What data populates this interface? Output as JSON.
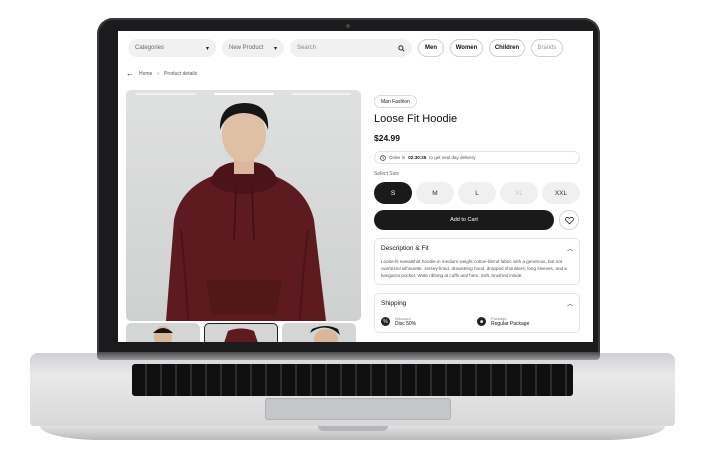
{
  "header": {
    "categories_label": "Categories",
    "new_product_label": "New Product",
    "search_placeholder": "Search",
    "filters": [
      "Men",
      "Women",
      "Children",
      "Brands"
    ]
  },
  "breadcrumb": {
    "home": "Home",
    "separator": "›",
    "current": "Product details"
  },
  "product": {
    "tag": "Man Fashion",
    "title": "Loose Fit Hoodie",
    "price": "$24.99",
    "delivery_prefix": "Order in",
    "delivery_time": "02:30:25",
    "delivery_suffix": "to get next day delivery",
    "size_label": "Select Size",
    "sizes": [
      "S",
      "M",
      "L",
      "XL",
      "XXL"
    ],
    "selected_size": "S",
    "disabled_size": "XL",
    "add_to_cart": "Add to Cart",
    "hoodie_color": "#5e1b1f"
  },
  "description": {
    "title": "Description & Fit",
    "text": "Loose-fit sweatshirt hoodie in medium weight cotton-blend fabric with a generous, but not oversized silhouette. Jersey-lined, drawstring hood, dropped shoulders, long sleeves, and a kangaroo pocket. Wide ribbing at cuffs and hem. Soft, brushed inside."
  },
  "shipping": {
    "title": "Shipping",
    "discount_label": "Discount",
    "discount_value": "Disc 50%",
    "package_label": "Package",
    "package_value": "Regular Package"
  }
}
